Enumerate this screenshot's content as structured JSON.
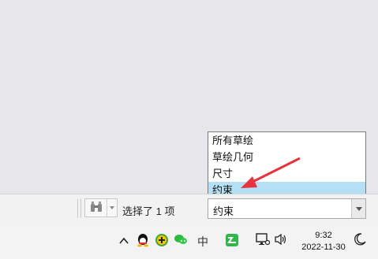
{
  "dropdown": {
    "items": [
      {
        "label": "所有草绘",
        "selected": false
      },
      {
        "label": "草绘几何",
        "selected": false
      },
      {
        "label": "尺寸",
        "selected": false
      },
      {
        "label": "约束",
        "selected": true
      }
    ]
  },
  "statusbar": {
    "selected_text": "选择了 1 项",
    "filter_value": "约束",
    "find_icon": "binoculars-icon"
  },
  "taskbar": {
    "tray_icons": [
      "chevron-up-icon",
      "qq-icon",
      "plus-circle-icon",
      "wechat-icon",
      "ime-icon",
      "wps-icon",
      "network-icon",
      "volume-icon"
    ],
    "ime_label": "中",
    "time": "9:32",
    "date": "2022-11-30",
    "notification_icon": "moon-icon"
  },
  "colors": {
    "highlight": "#b5dff5",
    "annotation_arrow": "#e8323c"
  }
}
